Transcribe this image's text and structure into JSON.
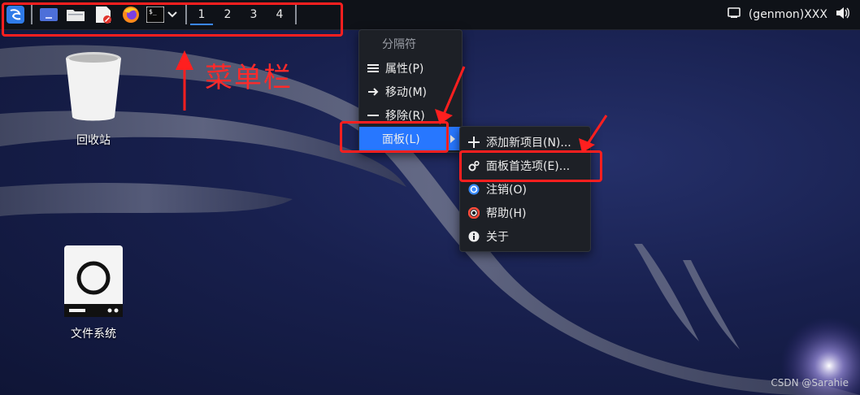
{
  "panel": {
    "workspaces": [
      "1",
      "2",
      "3",
      "4"
    ],
    "active_workspace_index": 0,
    "genmon_label": "(genmon)XXX"
  },
  "annotation": {
    "label": "菜单栏"
  },
  "desktop": {
    "icons": [
      {
        "label": "回收站",
        "icon": "trash-icon"
      },
      {
        "label": "文件系统",
        "icon": "drive-icon"
      }
    ]
  },
  "context_menu": {
    "header": "分隔符",
    "items": [
      {
        "label": "属性(P)",
        "icon": "list-icon"
      },
      {
        "label": "移动(M)",
        "icon": "arrow-right-icon"
      },
      {
        "label": "移除(R)",
        "icon": "minus-icon"
      },
      {
        "label": "面板(L)",
        "icon": "",
        "selected": true,
        "has_submenu": true
      }
    ]
  },
  "panel_submenu": {
    "items": [
      {
        "label": "添加新项目(N)...",
        "icon": "plus-icon"
      },
      {
        "label": "面板首选项(E)...",
        "icon": "gears-icon"
      },
      {
        "label": "注销(O)",
        "icon": "logout-icon"
      },
      {
        "label": "帮助(H)",
        "icon": "lifebuoy-icon"
      },
      {
        "label": "关于",
        "icon": "info-icon"
      }
    ]
  },
  "colors": {
    "annotation": "#ff1f1f",
    "selection": "#2777ff",
    "panel_bg": "#0f1218"
  },
  "watermark": "CSDN @Sarahie"
}
